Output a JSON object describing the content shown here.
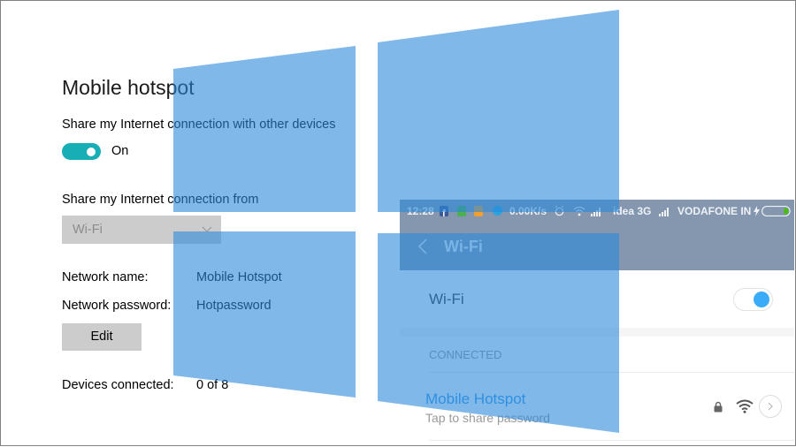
{
  "settings": {
    "title": "Mobile hotspot",
    "share_label": "Share my Internet connection with other devices",
    "share_toggle": {
      "state_label": "On",
      "on": true
    },
    "share_from_label": "Share my Internet connection from",
    "share_from_select": {
      "value": "Wi-Fi"
    },
    "network_name_label": "Network name:",
    "network_name_value": "Mobile Hotspot",
    "network_password_label": "Network password:",
    "network_password_value": "Hotpassword",
    "edit_button": "Edit",
    "devices_connected_label": "Devices connected:",
    "devices_connected_value": "0 of 8"
  },
  "phone": {
    "status_bar": {
      "time": "12:28",
      "net_speed": "0.00K/s",
      "carrier_1": "idea 3G",
      "carrier_2": "VODAFONE IN",
      "icons": [
        "facebook-icon",
        "phone-app-icon",
        "app-icon",
        "download-icon",
        "alarm-icon",
        "wifi-icon",
        "signal-icon",
        "signal-icon",
        "charging-icon",
        "battery-icon"
      ]
    },
    "header": {
      "title": "Wi-Fi"
    },
    "wifi_row": {
      "label": "Wi-Fi",
      "enabled": true
    },
    "section_header": "CONNECTED",
    "network": {
      "name": "Mobile Hotspot",
      "subtitle": "Tap to share password",
      "secured": true
    }
  },
  "colors": {
    "toggle_accent": "#17aeb6",
    "phone_header": "#8497af",
    "phone_accent": "#3a9be8",
    "windows_logo": "#2989da"
  }
}
